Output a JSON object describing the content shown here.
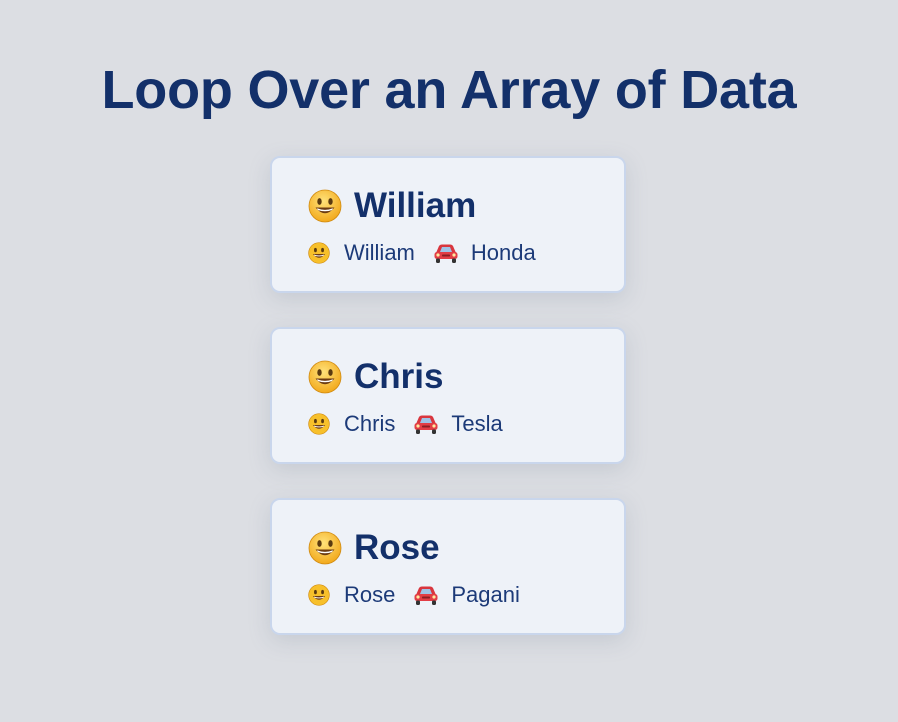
{
  "page": {
    "title": "Loop Over an Array of Data"
  },
  "people": [
    {
      "name": "William",
      "detail_name": "William",
      "car": "Honda"
    },
    {
      "name": "Chris",
      "detail_name": "Chris",
      "car": "Tesla"
    },
    {
      "name": "Rose",
      "detail_name": "Rose",
      "car": "Pagani"
    }
  ],
  "icons": {
    "person": "smiley-face-icon",
    "car": "red-car-icon"
  },
  "colors": {
    "background": "#dcdee3",
    "card_background": "#eef2f8",
    "card_border": "#c9d6ec",
    "text": "#13306a",
    "smiley": "#f7c02b",
    "car": "#d9363e"
  }
}
